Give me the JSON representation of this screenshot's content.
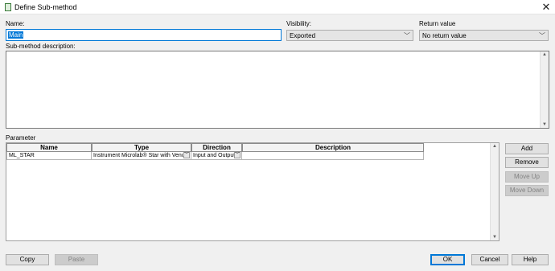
{
  "window": {
    "title": "Define Sub-method",
    "close_glyph": "✕"
  },
  "name": {
    "label": "Name:",
    "value": "Main"
  },
  "visibility": {
    "label": "Visibility:",
    "value": "Exported"
  },
  "return_value": {
    "label": "Return value",
    "value": "No return value"
  },
  "description": {
    "label": "Sub-method description:",
    "value": ""
  },
  "parameter": {
    "label": "Parameter",
    "columns": [
      "Name",
      "Type",
      "Direction",
      "Description"
    ],
    "rows": [
      {
        "name": "ML_STAR",
        "type": "Instrument Microlab® Star with Venus",
        "direction": "Input and Output",
        "description": ""
      }
    ]
  },
  "side_buttons": {
    "add": "Add",
    "remove": "Remove",
    "move_up": "Move Up",
    "move_down": "Move Down"
  },
  "bottom_buttons": {
    "copy": "Copy",
    "paste": "Paste",
    "ok": "OK",
    "cancel": "Cancel",
    "help": "Help"
  },
  "icons": {
    "app": "document-icon",
    "dropdown": "chevron-down-icon",
    "scroll_up": "scroll-up-icon",
    "scroll_down": "scroll-down-icon"
  },
  "colors": {
    "accent": "#0078d7",
    "window_bg": "#f0f0f0"
  }
}
